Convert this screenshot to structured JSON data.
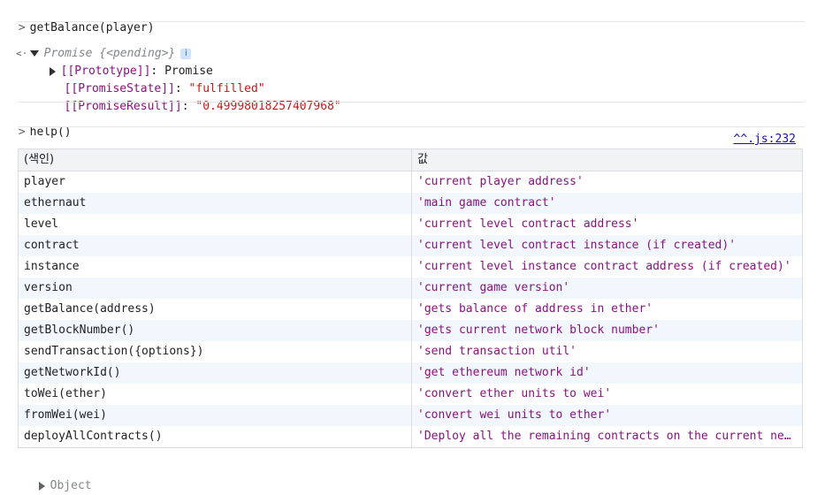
{
  "console": {
    "input1": "getBalance(player)",
    "promise_label": "Promise {<pending>}",
    "info_badge": "i",
    "prototype_key": "[[Prototype]]",
    "prototype_value": "Promise",
    "state_key": "[[PromiseState]]",
    "state_value": "\"fulfilled\"",
    "result_key": "[[PromiseResult]]",
    "result_value": "\"0.49998018257407968\"",
    "input2": "help()",
    "source_link": "^^.js:232",
    "object_label": "Object",
    "prompt_glyph": ">",
    "return_glyph": "<·",
    "colon": ": "
  },
  "table": {
    "headers": [
      "(색인)",
      "값"
    ],
    "rows": [
      {
        "index": "player",
        "value": "'current player address'"
      },
      {
        "index": "ethernaut",
        "value": "'main game contract'"
      },
      {
        "index": "level",
        "value": "'current level contract address'"
      },
      {
        "index": "contract",
        "value": "'current level contract instance (if created)'"
      },
      {
        "index": "instance",
        "value": "'current level instance contract address (if created)'"
      },
      {
        "index": "version",
        "value": "'current game version'"
      },
      {
        "index": "getBalance(address)",
        "value": "'gets balance of address in ether'"
      },
      {
        "index": "getBlockNumber()",
        "value": "'gets current network block number'"
      },
      {
        "index": "sendTransaction({options})",
        "value": "'send transaction util'"
      },
      {
        "index": "getNetworkId()",
        "value": "'get ethereum network id'"
      },
      {
        "index": "toWei(ether)",
        "value": "'convert ether units to wei'"
      },
      {
        "index": "fromWei(wei)",
        "value": "'convert wei units to ether'"
      },
      {
        "index": "deployAllContracts()",
        "value": "'Deploy all the remaining contracts on the current network.'"
      }
    ]
  }
}
